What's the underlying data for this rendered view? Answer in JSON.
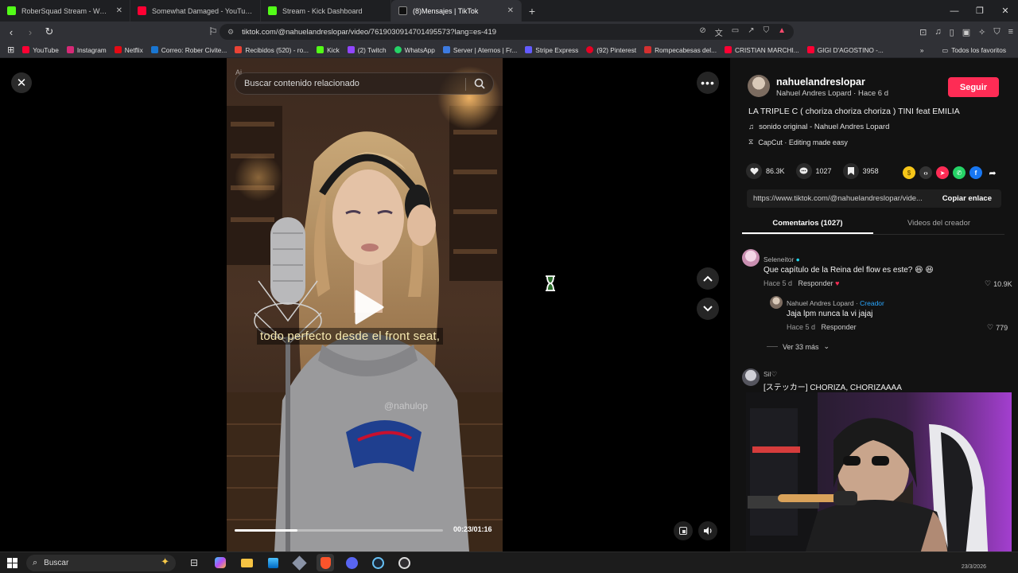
{
  "browser": {
    "tabs": [
      {
        "label": "RoberSquad Stream - Watch Live",
        "color": "#53fc18",
        "active": false
      },
      {
        "label": "Somewhat Damaged - YouTube",
        "color": "#ff0033",
        "active": false
      },
      {
        "label": "Stream - Kick Dashboard",
        "color": "#53fc18",
        "active": false
      },
      {
        "label": "(8)Mensajes | TikTok",
        "color": "#ffffff",
        "active": true
      }
    ],
    "url": "tiktok.com/@nahuelandreslopar/video/7619030914701495573?lang=es-419",
    "bookmarks": [
      {
        "label": "YouTube",
        "color": "#ff0033"
      },
      {
        "label": "Instagram",
        "color": "#d62976"
      },
      {
        "label": "Netflix",
        "color": "#e50914"
      },
      {
        "label": "Correo: Rober Civite...",
        "color": "#1976d2"
      },
      {
        "label": "Recibidos (520) - ro...",
        "color": "#ea4335"
      },
      {
        "label": "Kick",
        "color": "#53fc18"
      },
      {
        "label": "(2) Twitch",
        "color": "#9146ff"
      },
      {
        "label": "WhatsApp",
        "color": "#25d366"
      },
      {
        "label": "Server | Aternos | Fr...",
        "color": "#3d7be0"
      },
      {
        "label": "Stripe Express",
        "color": "#635bff"
      },
      {
        "label": "(92) Pinterest",
        "color": "#e60023"
      },
      {
        "label": "Rompecabesas del...",
        "color": "#d43030"
      },
      {
        "label": "CRISTIAN MARCHI...",
        "color": "#ff0033"
      },
      {
        "label": "GIGI D'AGOSTINO -...",
        "color": "#ff0033"
      }
    ],
    "bookmarks_all": "Todos los favoritos"
  },
  "video": {
    "search_placeholder": "Buscar contenido relacionado",
    "ai_tag": "Ai",
    "subtitle": "todo perfecto desde el front seat,",
    "watermark": "@nahulop",
    "timecode": "00:23/01:16",
    "progress_fraction": 0.3
  },
  "post": {
    "username": "nahuelandreslopar",
    "subline": "Nahuel Andres Lopard · Hace 6 d",
    "follow_label": "Seguir",
    "caption": "LA TRIPLE C ( choriza choriza choriza ) TINI feat EMILIA",
    "sound": "sonido original - Nahuel Andres Lopard",
    "capcut": "CapCut · Editing made easy",
    "likes": "86.3K",
    "comments": "1027",
    "saves": "3958",
    "link": "https://www.tiktok.com/@nahuelandreslopar/vide...",
    "copy_label": "Copiar enlace",
    "tab_comments": "Comentarios (1027)",
    "tab_videos": "Videos del creador"
  },
  "comments": [
    {
      "name": "Seleneitor",
      "text": "Que capítulo de la Reina del flow es este? 😆 😆",
      "time": "Hace 5 d",
      "reply": "Responder",
      "likes": "10.9K"
    },
    {
      "name": "Nahuel Andres Lopard",
      "creator": "Creador",
      "text": "Jaja lpm nunca la vi jajaj",
      "time": "Hace 5 d",
      "reply": "Responder",
      "likes": "779"
    },
    {
      "name": "Sil♡",
      "text": "[ステッカー] CHORIZA, CHORIZAAAA"
    }
  ],
  "ver_mas": "Ver 33 más",
  "taskbar": {
    "search_label": "Buscar",
    "clock": "23/3/2026"
  }
}
